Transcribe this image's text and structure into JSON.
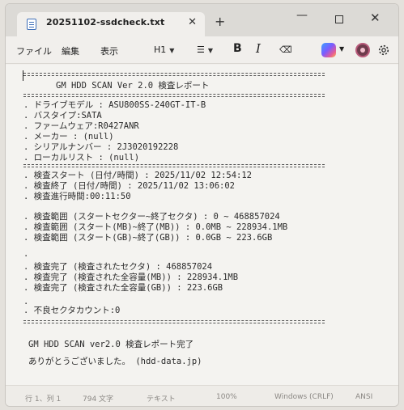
{
  "tab": {
    "title": "20251102-ssdcheck.txt",
    "close_glyph": "✕",
    "new_tab_glyph": "+"
  },
  "window_controls": {
    "minimize_glyph": "—",
    "close_glyph": "✕"
  },
  "menu": {
    "file": "ファイル",
    "edit": "編集",
    "view": "表示",
    "heading": "H1",
    "list_glyph": "☰",
    "bold": "B",
    "italic": "I",
    "clear_glyph": "⌫"
  },
  "document": {
    "title_line": "GM HDD SCAN Ver 2.0 検査レポート",
    "drive_model": ". ドライブモデル : ASU800SS-240GT-IT-B",
    "bus_type": ". バスタイプ:SATA",
    "firmware": ". ファームウェア:R0427ANR",
    "maker": ". メーカー : (null)",
    "serial": ". シリアルナンバー : 2J3020192228",
    "local_list": ". ローカルリスト : (null)",
    "scan_start": ". 検査スタート (日付/時間) : 2025/11/02 12:54:12",
    "scan_end": ". 検査終了 (日付/時間) : 2025/11/02 13:06:02",
    "scan_elapsed": ". 検査進行時間:00:11:50",
    "range_sector": ". 検査範囲 (スタートセクター~終了セクタ) : 0 ~ 468857024",
    "range_mb": ". 検査範囲 (スタート(MB)~終了(MB)) : 0.0MB ~ 228934.1MB",
    "range_gb": ". 検査範囲 (スタート(GB)~終了(GB)) : 0.0GB ~ 223.6GB",
    "done_sector": ". 検査完了 (検査されたセクタ) : 468857024",
    "done_mb": ". 検査完了 (検査された全容量(MB)) : 228934.1MB",
    "done_gb": ". 検査完了 (検査された全容量(GB)) : 223.6GB",
    "dot": ".",
    "bad_sector": ". 不良セクタカウント:0",
    "footer_complete": "GM HDD SCAN ver2.0 検査レポート完了",
    "footer_thanks": "ありがとうございました。 (hdd-data.jp)"
  },
  "status": {
    "position": "行 1、列 1",
    "chars": "794 文字",
    "type": "テキスト",
    "zoom": "100%",
    "line_ending": "Windows (CRLF)",
    "encoding": "ANSI"
  },
  "colors": {
    "accent_icon": "#3e6fb8"
  }
}
